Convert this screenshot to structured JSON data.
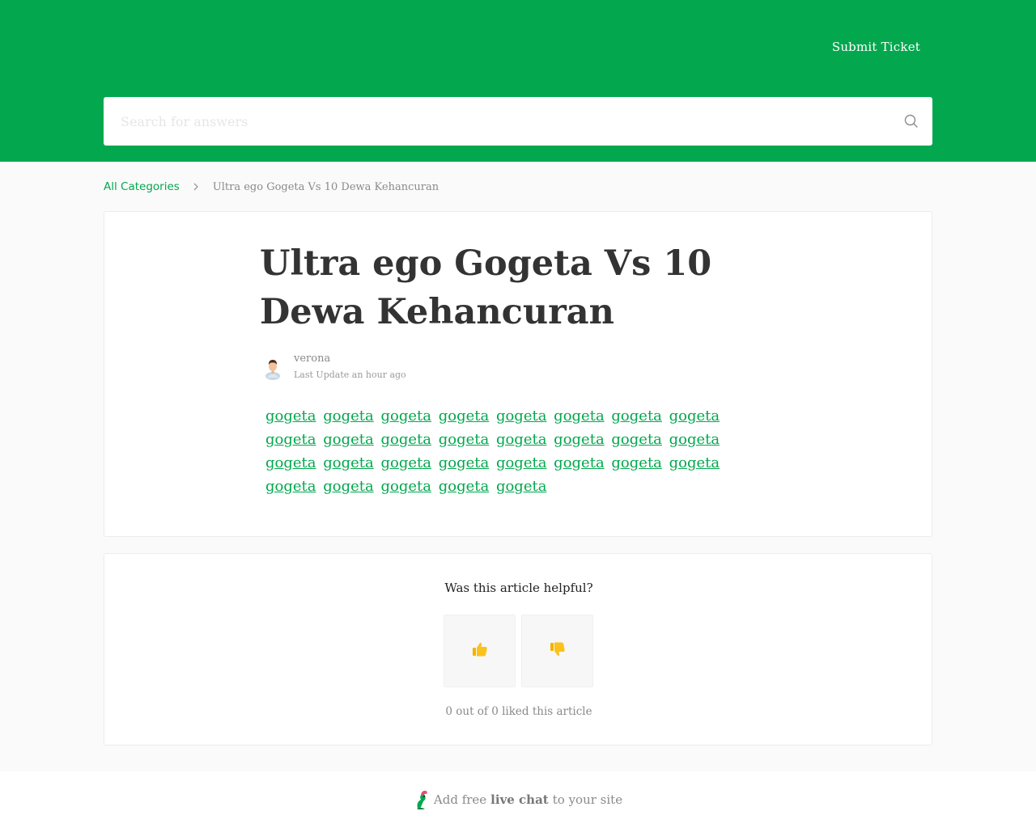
{
  "header": {
    "submit_ticket_label": "Submit Ticket",
    "brand_color": "#03a84e"
  },
  "search": {
    "placeholder": "Search for answers",
    "icon": "search-icon"
  },
  "breadcrumb": {
    "root_label": "All Categories",
    "separator_icon": "chevron-right-icon",
    "current_label": "Ultra ego Gogeta Vs 10 Dewa Kehancuran"
  },
  "article": {
    "title": "Ultra ego Gogeta Vs 10 Dewa Kehancuran",
    "author_name": "verona",
    "last_update": "Last Update an hour ago",
    "body_links": [
      "gogeta",
      "gogeta",
      "gogeta",
      "gogeta",
      "gogeta",
      "gogeta",
      "gogeta",
      "gogeta",
      "gogeta",
      "gogeta",
      "gogeta",
      "gogeta",
      "gogeta",
      "gogeta",
      "gogeta",
      "gogeta",
      "gogeta",
      "gogeta",
      "gogeta",
      "gogeta",
      "gogeta",
      "gogeta",
      "gogeta",
      "gogeta",
      "gogeta",
      "gogeta",
      "gogeta",
      "gogeta",
      "gogeta"
    ]
  },
  "feedback": {
    "question": "Was this article helpful?",
    "thumbs_up_icon": "thumbs-up-icon",
    "thumbs_down_icon": "thumbs-down-icon",
    "count_text": "0 out of 0 liked this article"
  },
  "footer": {
    "prefix": "Add free",
    "bold": "live chat",
    "suffix": "to your site"
  }
}
